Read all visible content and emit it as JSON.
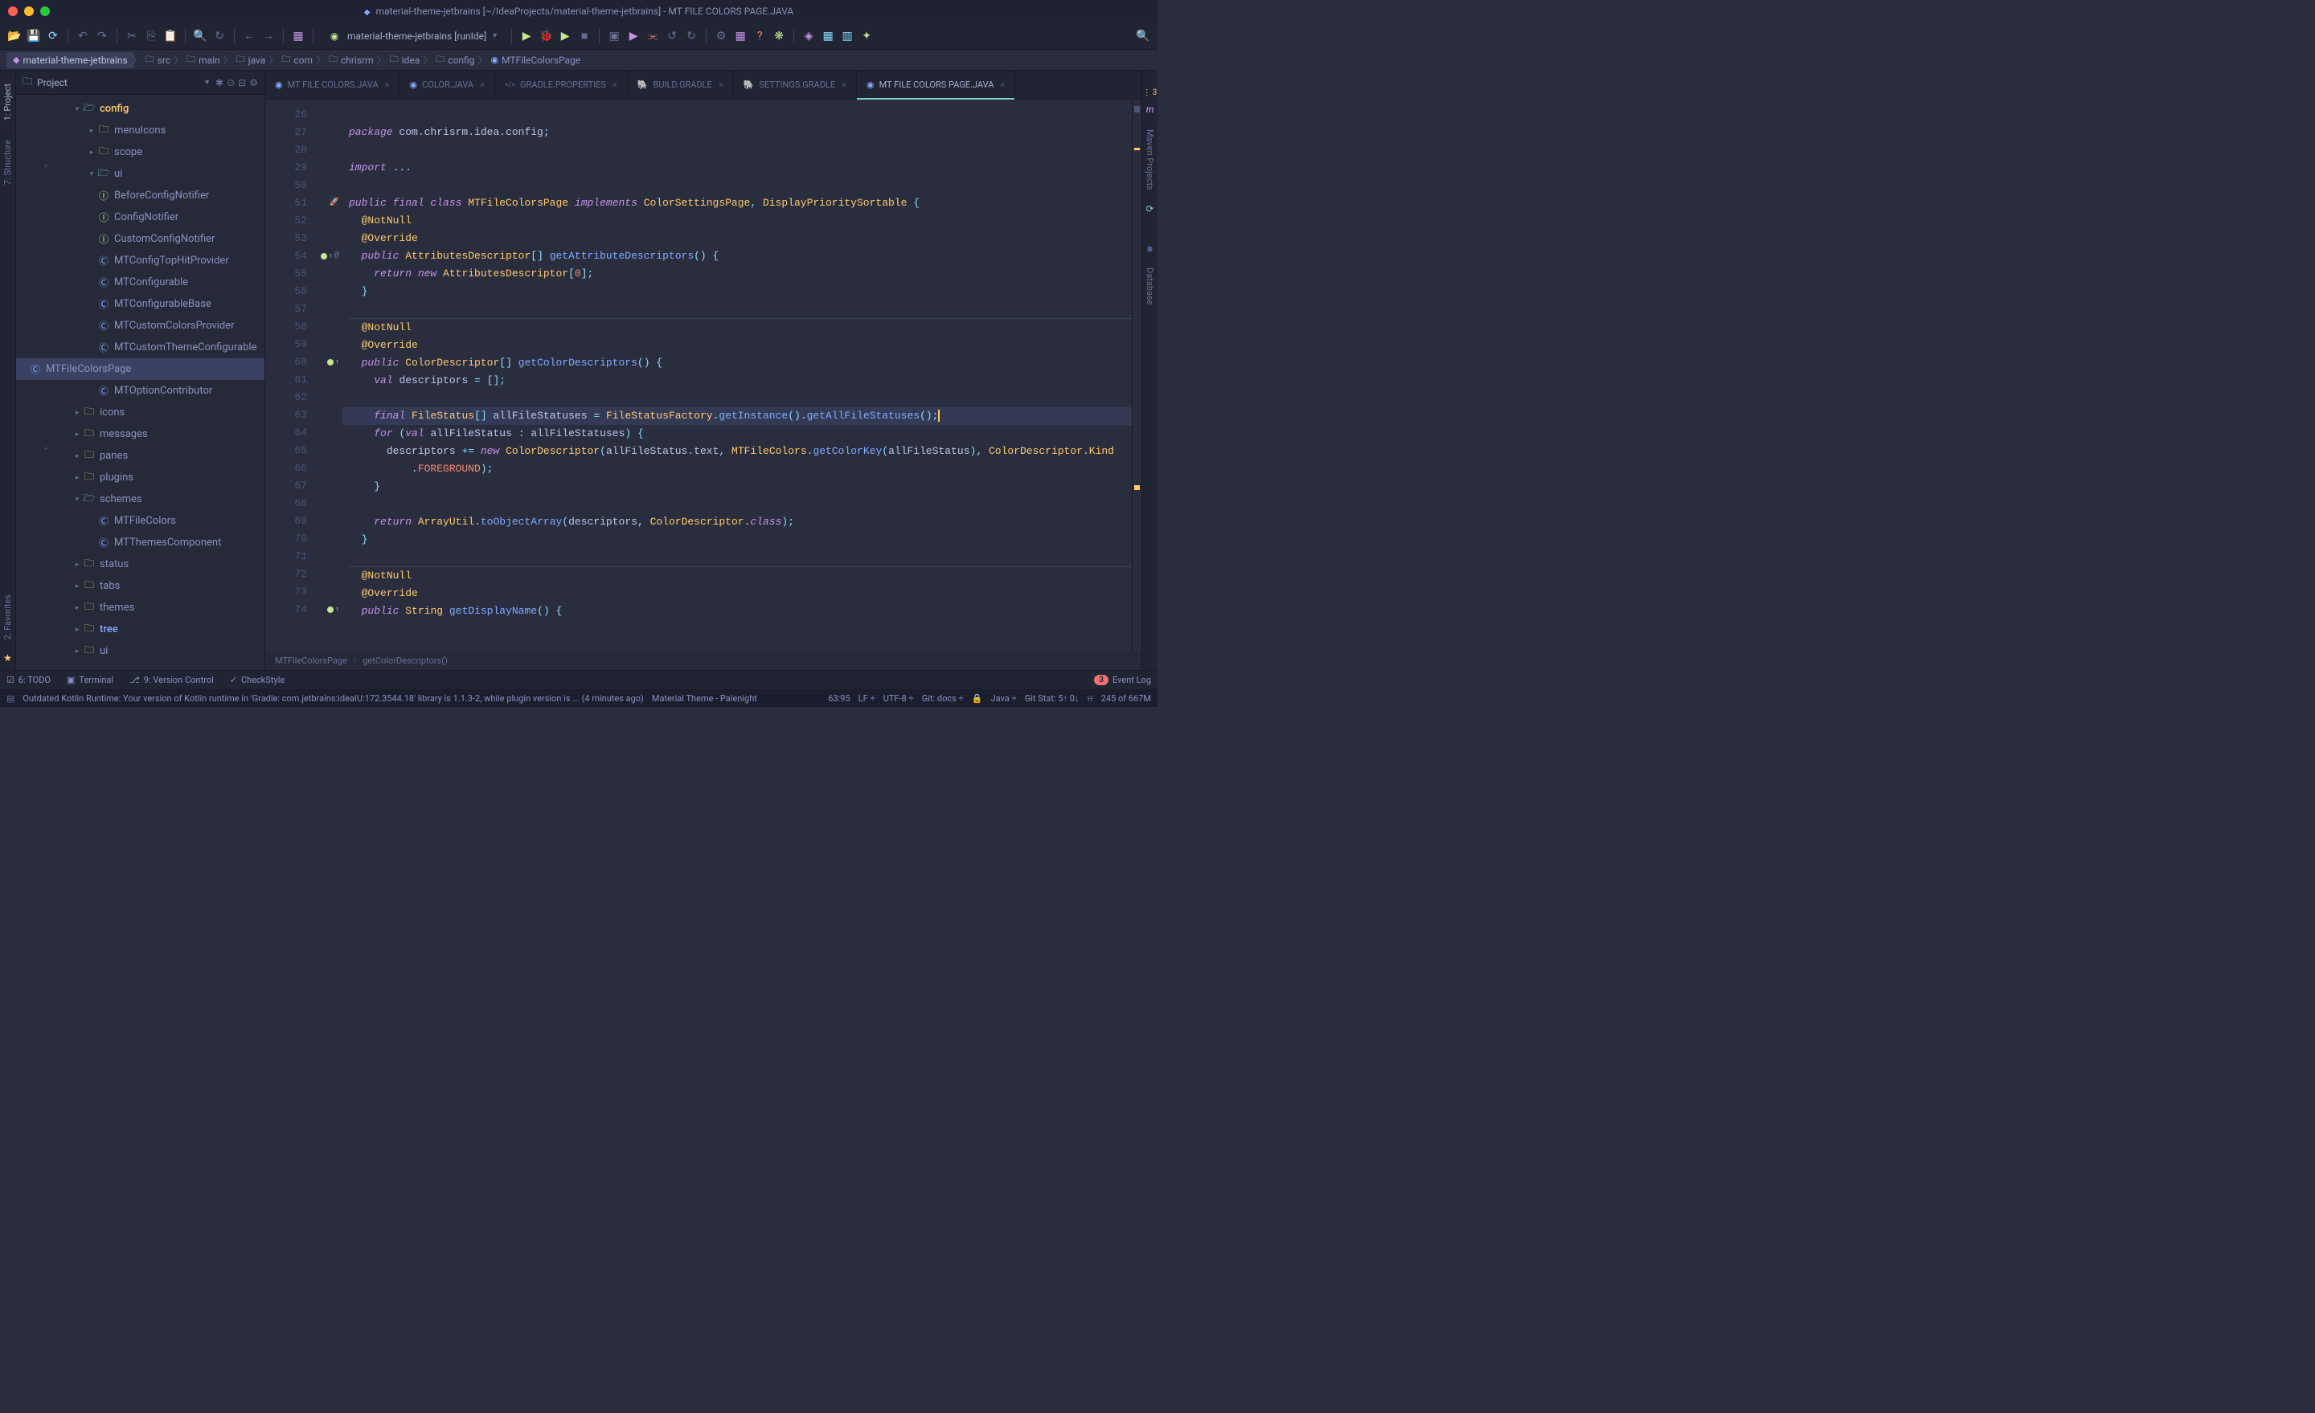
{
  "titlebar": {
    "title": "material-theme-jetbrains [~/IdeaProjects/material-theme-jetbrains] - MT FILE COLORS PAGE.JAVA"
  },
  "run_config": {
    "label": "material-theme-jetbrains [runIde]"
  },
  "breadcrumbs": {
    "items": [
      {
        "label": "material-theme-jetbrains",
        "cls": "bc-proj"
      },
      {
        "label": "src"
      },
      {
        "label": "main"
      },
      {
        "label": "java"
      },
      {
        "label": "com"
      },
      {
        "label": "chrisrm"
      },
      {
        "label": "idea"
      },
      {
        "label": "config"
      },
      {
        "label": "MTFileColorsPage"
      }
    ]
  },
  "panel": {
    "title": "Project"
  },
  "tree": [
    {
      "label": "config",
      "kind": "folder-open",
      "indent": 1,
      "caret": "down",
      "hl": "folder-hl"
    },
    {
      "label": "menuIcons",
      "kind": "folder",
      "indent": 2,
      "caret": "right"
    },
    {
      "label": "scope",
      "kind": "folder",
      "indent": 2,
      "caret": "right"
    },
    {
      "label": "ui",
      "kind": "folder-open",
      "indent": 2,
      "caret": "down"
    },
    {
      "label": "BeforeConfigNotifier",
      "kind": "interface",
      "indent": 2
    },
    {
      "label": "ConfigNotifier",
      "kind": "interface",
      "indent": 2
    },
    {
      "label": "CustomConfigNotifier",
      "kind": "interface",
      "indent": 2
    },
    {
      "label": "MTConfigTopHitProvider",
      "kind": "class",
      "indent": 2
    },
    {
      "label": "MTConfigurable",
      "kind": "class",
      "indent": 2
    },
    {
      "label": "MTConfigurableBase",
      "kind": "class",
      "indent": 2
    },
    {
      "label": "MTCustomColorsProvider",
      "kind": "class",
      "indent": 2
    },
    {
      "label": "MTCustomThemeConfigurable",
      "kind": "class",
      "indent": 2
    },
    {
      "label": "MTFileColorsPage",
      "kind": "class",
      "indent": 2,
      "selected": true
    },
    {
      "label": "MTOptionContributor",
      "kind": "class",
      "indent": 2
    },
    {
      "label": "icons",
      "kind": "folder",
      "indent": 1,
      "caret": "right"
    },
    {
      "label": "messages",
      "kind": "folder",
      "indent": 1,
      "caret": "right"
    },
    {
      "label": "panes",
      "kind": "folder",
      "indent": 1,
      "caret": "right"
    },
    {
      "label": "plugins",
      "kind": "folder",
      "indent": 1,
      "caret": "right"
    },
    {
      "label": "schemes",
      "kind": "folder-open",
      "indent": 1,
      "caret": "down"
    },
    {
      "label": "MTFileColors",
      "kind": "class",
      "indent": 2
    },
    {
      "label": "MTThemesComponent",
      "kind": "class",
      "indent": 2
    },
    {
      "label": "status",
      "kind": "folder",
      "indent": 1,
      "caret": "right"
    },
    {
      "label": "tabs",
      "kind": "folder",
      "indent": 1,
      "caret": "right"
    },
    {
      "label": "themes",
      "kind": "folder",
      "indent": 1,
      "caret": "right"
    },
    {
      "label": "tree",
      "kind": "folder",
      "indent": 1,
      "caret": "right",
      "hl": "tree-hl"
    },
    {
      "label": "ui",
      "kind": "folder",
      "indent": 1,
      "caret": "right"
    }
  ],
  "editor_tabs": [
    {
      "label": "MT FILE COLORS.JAVA",
      "ico": "java"
    },
    {
      "label": "COLOR.JAVA",
      "ico": "java"
    },
    {
      "label": "GRADLE.PROPERTIES",
      "ico": "props"
    },
    {
      "label": "BUILD.GRADLE",
      "ico": "gradle"
    },
    {
      "label": "SETTINGS.GRADLE",
      "ico": "gradle"
    },
    {
      "label": "MT FILE COLORS PAGE.JAVA",
      "ico": "java",
      "active": true
    }
  ],
  "tabs_widget": {
    "count": "3"
  },
  "gutter": {
    "start": 26,
    "lines": [
      "26",
      "27",
      "28",
      "29",
      "50",
      "51",
      "52",
      "53",
      "54",
      "55",
      "56",
      "57",
      "58",
      "59",
      "60",
      "61",
      "62",
      "63",
      "64",
      "65",
      "66",
      "67",
      "68",
      "69",
      "70",
      "71",
      "72",
      "73",
      "74"
    ]
  },
  "code": {
    "package_line": "com.chrisrm.idea.config",
    "import_line": "...",
    "class_sig": {
      "pre": "public final class ",
      "name": "MTFileColorsPage",
      "mid": " implements ",
      "impl1": "ColorSettingsPage",
      "sep": ", ",
      "impl2": "DisplayPrioritySortable",
      "end": " {"
    },
    "ann_notnull": "@NotNull",
    "ann_override": "@Override",
    "m1_sig": {
      "ret": "AttributesDescriptor",
      "name": "getAttributeDescriptors"
    },
    "m1_ret": {
      "cls": "AttributesDescriptor",
      "idx": "0"
    },
    "m2_sig": {
      "ret": "ColorDescriptor",
      "name": "getColorDescriptors"
    },
    "m2_val": {
      "name": "descriptors"
    },
    "m2_final": {
      "cls": "FileStatus",
      "var": "allFileStatuses",
      "factory": "FileStatusFactory",
      "getInst": "getInstance",
      "getAll": "getAllFileStatuses"
    },
    "m2_for": {
      "var": "allFileStatus",
      "it": "allFileStatuses"
    },
    "m2_desc": {
      "var": "descriptors",
      "cls": "ColorDescriptor",
      "arg1": "allFileStatus",
      "prop": "text",
      "mtc": "MTFileColors",
      "getKey": "getColorKey",
      "kind": "ColorDescriptor",
      "kind2": "Kind"
    },
    "m2_fg": "FOREGROUND",
    "m2_return": {
      "util": "ArrayUtil",
      "fn": "toObjectArray",
      "a1": "descriptors",
      "a2": "ColorDescriptor",
      "cls": "class"
    },
    "m3_sig": {
      "ret": "String",
      "name": "getDisplayName"
    }
  },
  "editor_breadcrumb": {
    "items": [
      "MTFileColorsPage",
      "getColorDescriptors()"
    ]
  },
  "left_rail": {
    "items": [
      "1: Project",
      "7: Structure"
    ],
    "bottom": [
      "2: Favorites"
    ]
  },
  "right_rail": {
    "items": [
      "Maven Projects",
      "Database"
    ]
  },
  "bottom_tabs": {
    "items": [
      {
        "label": "6: TODO",
        "ico": "☑"
      },
      {
        "label": "Terminal",
        "ico": "▣"
      },
      {
        "label": "9: Version Control",
        "ico": "⎇"
      },
      {
        "label": "CheckStyle",
        "ico": "✓"
      }
    ],
    "event_log": {
      "label": "Event Log",
      "count": "3"
    }
  },
  "status": {
    "msg": "Outdated Kotlin Runtime: Your version of Kotlin runtime in 'Gradle: com.jetbrains:ideaIU:172.3544.18' library is 1.1.3-2, while plugin version is ... (4 minutes ago)",
    "theme": "Material Theme - Palenight",
    "pos": "63:95",
    "sep": "LF",
    "enc": "UTF-8",
    "git": "Git: docs",
    "lang": "Java",
    "gitstat": "Git Stat: 5↑ 0↓",
    "mem": "245 of 667M"
  }
}
